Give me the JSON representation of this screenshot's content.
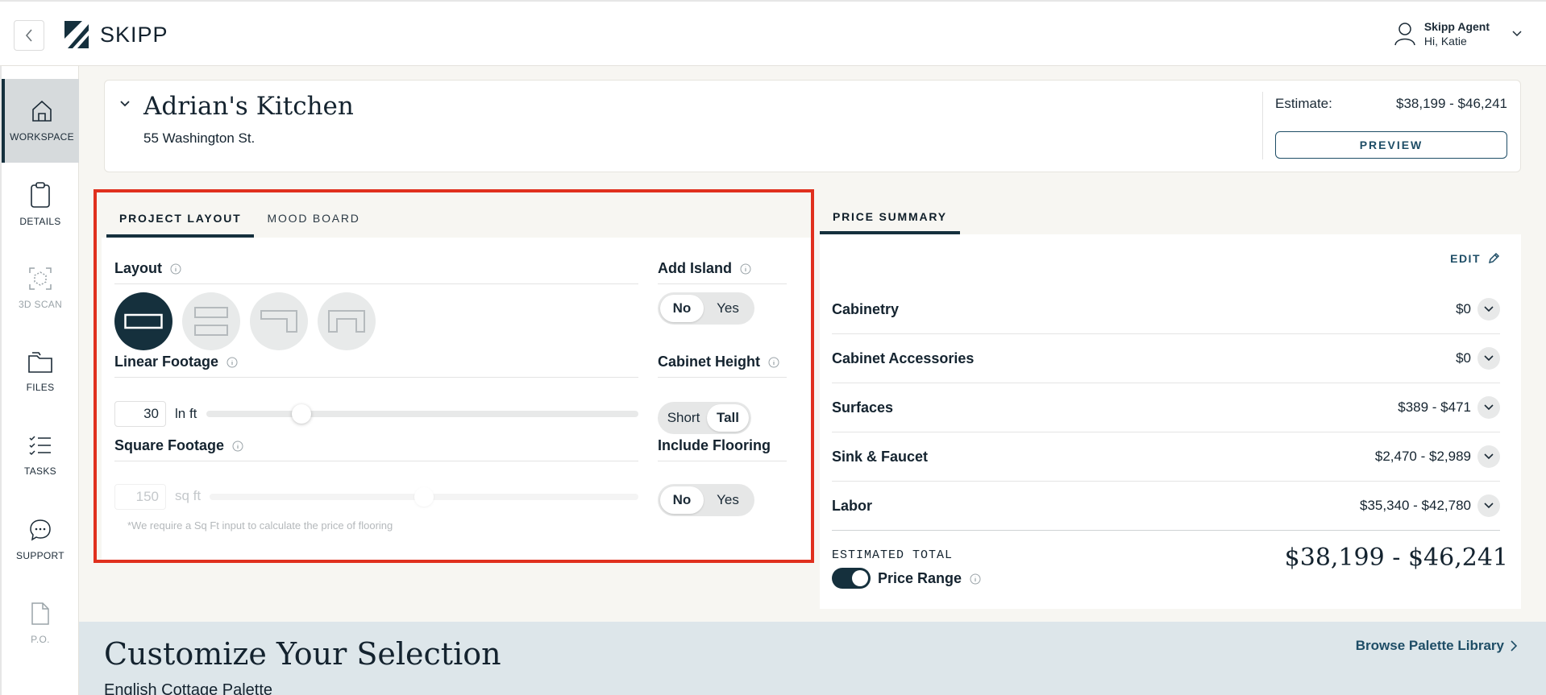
{
  "app": {
    "brand": "SKIPP"
  },
  "user": {
    "name": "Skipp Agent",
    "greeting": "Hi, Katie"
  },
  "sidebar": {
    "items": [
      {
        "label": "WORKSPACE",
        "icon": "home-icon",
        "active": true
      },
      {
        "label": "DETAILS",
        "icon": "clipboard-icon"
      },
      {
        "label": "3D SCAN",
        "icon": "scan-icon",
        "disabled": true
      },
      {
        "label": "FILES",
        "icon": "folder-icon"
      },
      {
        "label": "TASKS",
        "icon": "checklist-icon"
      },
      {
        "label": "SUPPORT",
        "icon": "chat-icon"
      },
      {
        "label": "P.O.",
        "icon": "document-icon",
        "disabled": true
      }
    ]
  },
  "project": {
    "title": "Adrian's Kitchen",
    "address": "55 Washington St.",
    "estimate_label": "Estimate:",
    "estimate_value": "$38,199 - $46,241",
    "preview_label": "PREVIEW"
  },
  "layout_panel": {
    "tabs": [
      "PROJECT LAYOUT",
      "MOOD BOARD"
    ],
    "active_tab": "PROJECT LAYOUT",
    "layout_label": "Layout",
    "layout_options": [
      "single-wall",
      "galley",
      "l-shape",
      "u-shape"
    ],
    "layout_selected": "single-wall",
    "add_island": {
      "label": "Add Island",
      "options": [
        "No",
        "Yes"
      ],
      "selected": "No"
    },
    "linear_footage": {
      "label": "Linear Footage",
      "value": "30",
      "unit": "ln ft",
      "level": 0.22
    },
    "cabinet_height": {
      "label": "Cabinet Height",
      "options": [
        "Short",
        "Tall"
      ],
      "selected": "Tall"
    },
    "square_footage": {
      "label": "Square Footage",
      "value": "150",
      "unit": "sq ft",
      "level": 0.5,
      "disabled": true
    },
    "include_flooring": {
      "label": "Include Flooring",
      "options": [
        "No",
        "Yes"
      ],
      "selected": "No"
    },
    "flooring_note": "*We require a Sq Ft input to calculate the price of flooring"
  },
  "price_summary": {
    "tab": "PRICE SUMMARY",
    "edit_label": "EDIT",
    "rows": [
      {
        "name": "Cabinetry",
        "value": "$0"
      },
      {
        "name": "Cabinet Accessories",
        "value": "$0"
      },
      {
        "name": "Surfaces",
        "value": "$389 - $471"
      },
      {
        "name": "Sink & Faucet",
        "value": "$2,470 - $2,989"
      },
      {
        "name": "Labor",
        "value": "$35,340 - $42,780"
      }
    ],
    "total_label": "ESTIMATED TOTAL",
    "total_value": "$38,199 - $46,241",
    "range_label": "Price Range",
    "range_on": true
  },
  "customize": {
    "title": "Customize Your Selection",
    "subtitle": "English Cottage Palette",
    "browse_label": "Browse Palette Library"
  },
  "colors": {
    "primary": "#15303d",
    "accent": "#1e4d66",
    "highlight": "#e0301e"
  }
}
